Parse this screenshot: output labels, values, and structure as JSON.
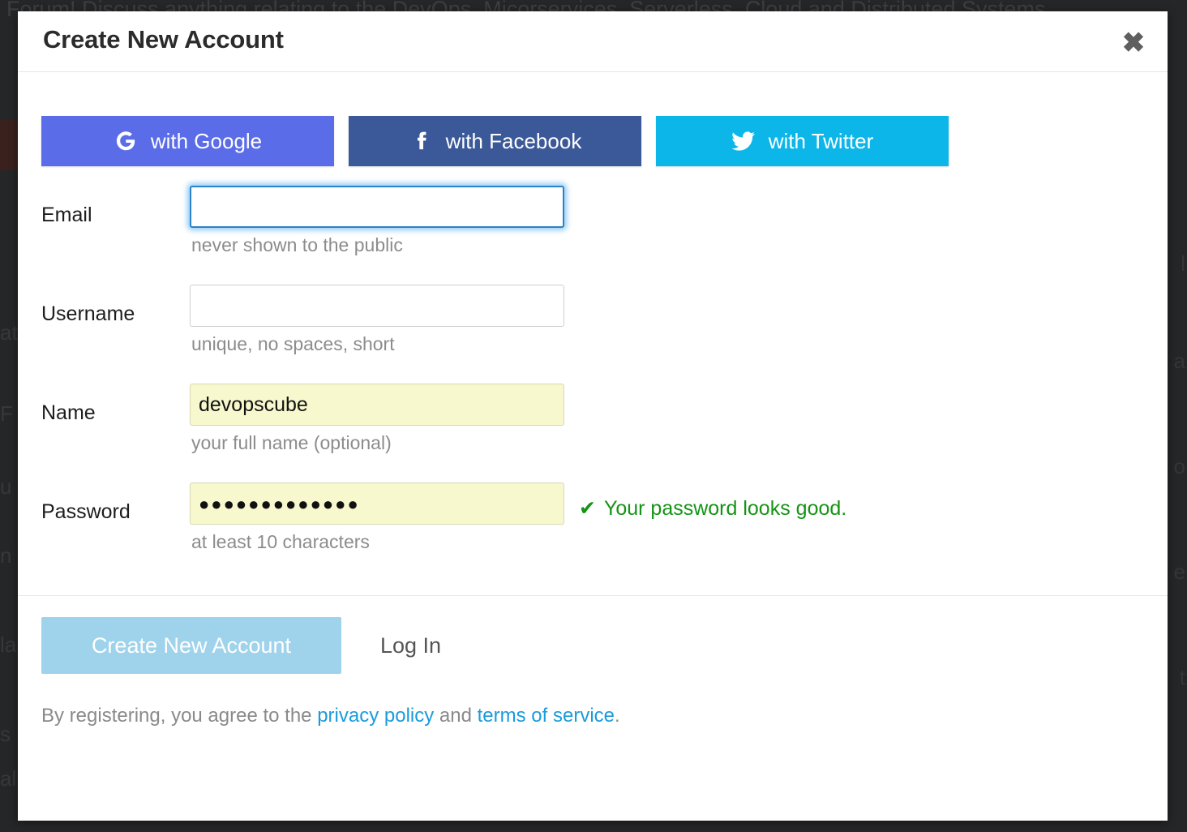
{
  "background": {
    "top_line": "Forum! Discuss anything relating to the DevOps, Micorservices, Serverless, Cloud and Distributed Systems",
    "left_fragments": [
      "atl",
      "F",
      "u",
      "n",
      "la",
      "s",
      "al"
    ],
    "right_fragments": [
      "l",
      "a",
      "o",
      "e",
      "t"
    ]
  },
  "modal": {
    "title": "Create New Account",
    "close_label": "✖"
  },
  "social": {
    "buttons": [
      {
        "id": "google",
        "icon": "google-icon",
        "label": "with Google",
        "color": "#5a6ce8"
      },
      {
        "id": "facebook",
        "icon": "facebook-icon",
        "label": "with Facebook",
        "color": "#3b5998"
      },
      {
        "id": "twitter",
        "icon": "twitter-icon",
        "label": "with Twitter",
        "color": "#0cb6e9"
      }
    ]
  },
  "form": {
    "fields": [
      {
        "id": "email",
        "label": "Email",
        "value": "",
        "placeholder": "",
        "hint": "never shown to the public",
        "state": "focused",
        "type": "email"
      },
      {
        "id": "username",
        "label": "Username",
        "value": "",
        "placeholder": "",
        "hint": "unique, no spaces, short",
        "state": "empty",
        "type": "text"
      },
      {
        "id": "name",
        "label": "Name",
        "value": "devopscube",
        "placeholder": "",
        "hint": "your full name (optional)",
        "state": "autofilled",
        "type": "text"
      },
      {
        "id": "password",
        "label": "Password",
        "value": "●●●●●●●●●●●●●",
        "placeholder": "",
        "hint": "at least 10 characters",
        "state": "autofilled",
        "type": "password",
        "note": "Your password looks good.",
        "note_icon": "✔",
        "note_color": "#149414"
      }
    ]
  },
  "footer": {
    "submit_label": "Create New Account",
    "login_label": "Log In",
    "legal_prefix": "By registering, you agree to the ",
    "privacy_label": "privacy policy",
    "legal_middle": " and ",
    "terms_label": "terms of service",
    "legal_suffix": "."
  }
}
